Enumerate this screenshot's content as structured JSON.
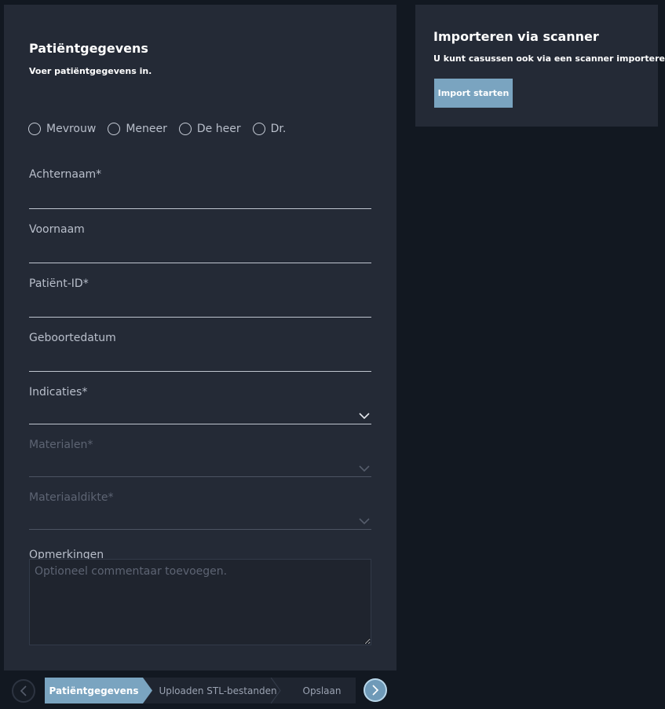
{
  "form": {
    "title": "Patiëntgegevens",
    "subtitle": "Voer patiëntgegevens in.",
    "salutations": [
      "Mevrouw",
      "Meneer",
      "De heer",
      "Dr."
    ],
    "fields": {
      "lastname": {
        "label": "Achternaam*",
        "value": ""
      },
      "firstname": {
        "label": "Voornaam",
        "value": ""
      },
      "patient_id": {
        "label": "Patiënt-ID*",
        "value": ""
      },
      "birthdate": {
        "label": "Geboortedatum",
        "value": ""
      },
      "indications": {
        "label": "Indicaties*",
        "value": "",
        "enabled": true
      },
      "materials": {
        "label": "Materialen*",
        "value": "",
        "enabled": false
      },
      "thickness": {
        "label": "Materiaaldikte*",
        "value": "",
        "enabled": false
      }
    },
    "remarks": {
      "label": "Opmerkingen",
      "placeholder": "Optioneel commentaar toevoegen."
    }
  },
  "scanner": {
    "title": "Importeren via scanner",
    "text": "U kunt casussen ook via een scanner importeren.",
    "button_label": "Import starten"
  },
  "stepper": {
    "steps": [
      {
        "label": "Patiëntgegevens",
        "active": true
      },
      {
        "label": "Uploaden STL-bestanden",
        "active": false
      },
      {
        "label": "Opslaan",
        "active": false
      }
    ],
    "prev_icon": "chevron-left-icon",
    "next_icon": "chevron-right-icon"
  },
  "colors": {
    "background": "#121821",
    "panel": "#242a36",
    "accent": "#7aa4c0",
    "text": "#ffffff",
    "muted_text": "#b9bfcb",
    "disabled_text": "#5d6473"
  }
}
